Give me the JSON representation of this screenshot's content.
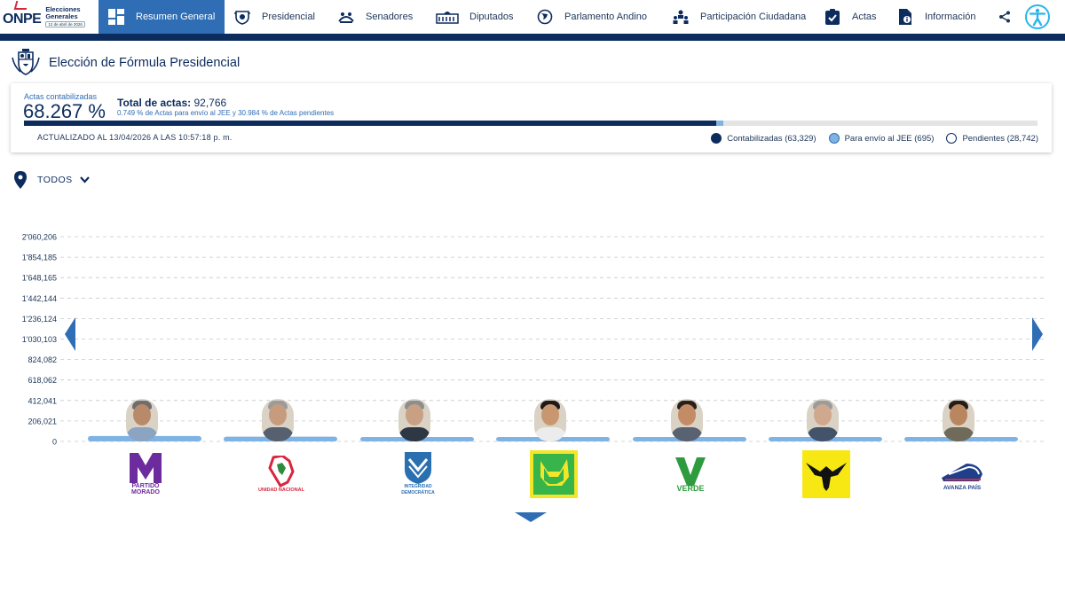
{
  "brand": {
    "name": "ONPE",
    "line1": "Elecciones",
    "line2": "Generales",
    "date": "12 de abril de 2026"
  },
  "nav": {
    "items": [
      {
        "label": "Resumen General",
        "icon": "dashboard-icon",
        "active": true
      },
      {
        "label": "Presidencial",
        "icon": "shield-icon",
        "active": false
      },
      {
        "label": "Senadores",
        "icon": "senate-icon",
        "active": false
      },
      {
        "label": "Diputados",
        "icon": "congress-building-icon",
        "active": false
      },
      {
        "label": "Parlamento Andino",
        "icon": "globe-icon",
        "active": false
      },
      {
        "label": "Participación Ciudadana",
        "icon": "people-icon",
        "active": false
      },
      {
        "label": "Actas",
        "icon": "clipboard-check-icon",
        "active": false
      },
      {
        "label": "Información",
        "icon": "document-info-icon",
        "active": false
      }
    ]
  },
  "header": {
    "title": "Elección de Fórmula Presidencial"
  },
  "status": {
    "actas_label": "Actas contabilizadas",
    "actas_pct": "68.267 %",
    "total_label": "Total de actas:",
    "total_value": "92,766",
    "note": "0.749 % de Actas para envío al JEE y 30.984 % de Actas pendientes",
    "progress_contabilizadas": 0.68267,
    "progress_jee": 0.00749,
    "updated": "ACTUALIZADO AL 13/04/2026 A LAS 10:57:18 p. m.",
    "legend": {
      "contabilizadas": "Contabilizadas (63,329)",
      "jee": "Para envío al JEE (695)",
      "pendientes": "Pendientes (28,742)"
    }
  },
  "filter": {
    "label": "TODOS"
  },
  "colors": {
    "navy": "#0d2c5e",
    "blue": "#2f6db5",
    "light": "#7fb3e3",
    "grid": "#c8c8c8"
  },
  "chart_data": {
    "type": "bar",
    "y_ticks": [
      "2'060,206",
      "1'854,185",
      "1'648,165",
      "1'442,144",
      "1'236,124",
      "1'030,103",
      "824,082",
      "618,062",
      "412,041",
      "206,021",
      "0"
    ],
    "ylim": [
      0,
      2060206
    ],
    "values": [
      55000,
      48000,
      42000,
      40000,
      35000,
      30000,
      22000
    ],
    "candidates": [
      {
        "party": "PARTIDO MORADO",
        "logo": "purple-m-logo"
      },
      {
        "party": "UNIDAD NACIONAL",
        "logo": "peru-map-logo"
      },
      {
        "party": "INTEGRIDAD DEMOCRÁTICA",
        "logo": "blue-shield-logo"
      },
      {
        "party": "",
        "logo": "green-dog-logo"
      },
      {
        "party": "VERDE",
        "logo": "green-v-logo"
      },
      {
        "party": "",
        "logo": "yellow-eagle-logo"
      },
      {
        "party": "AVANZA PAÍS",
        "logo": "train-logo"
      }
    ]
  }
}
